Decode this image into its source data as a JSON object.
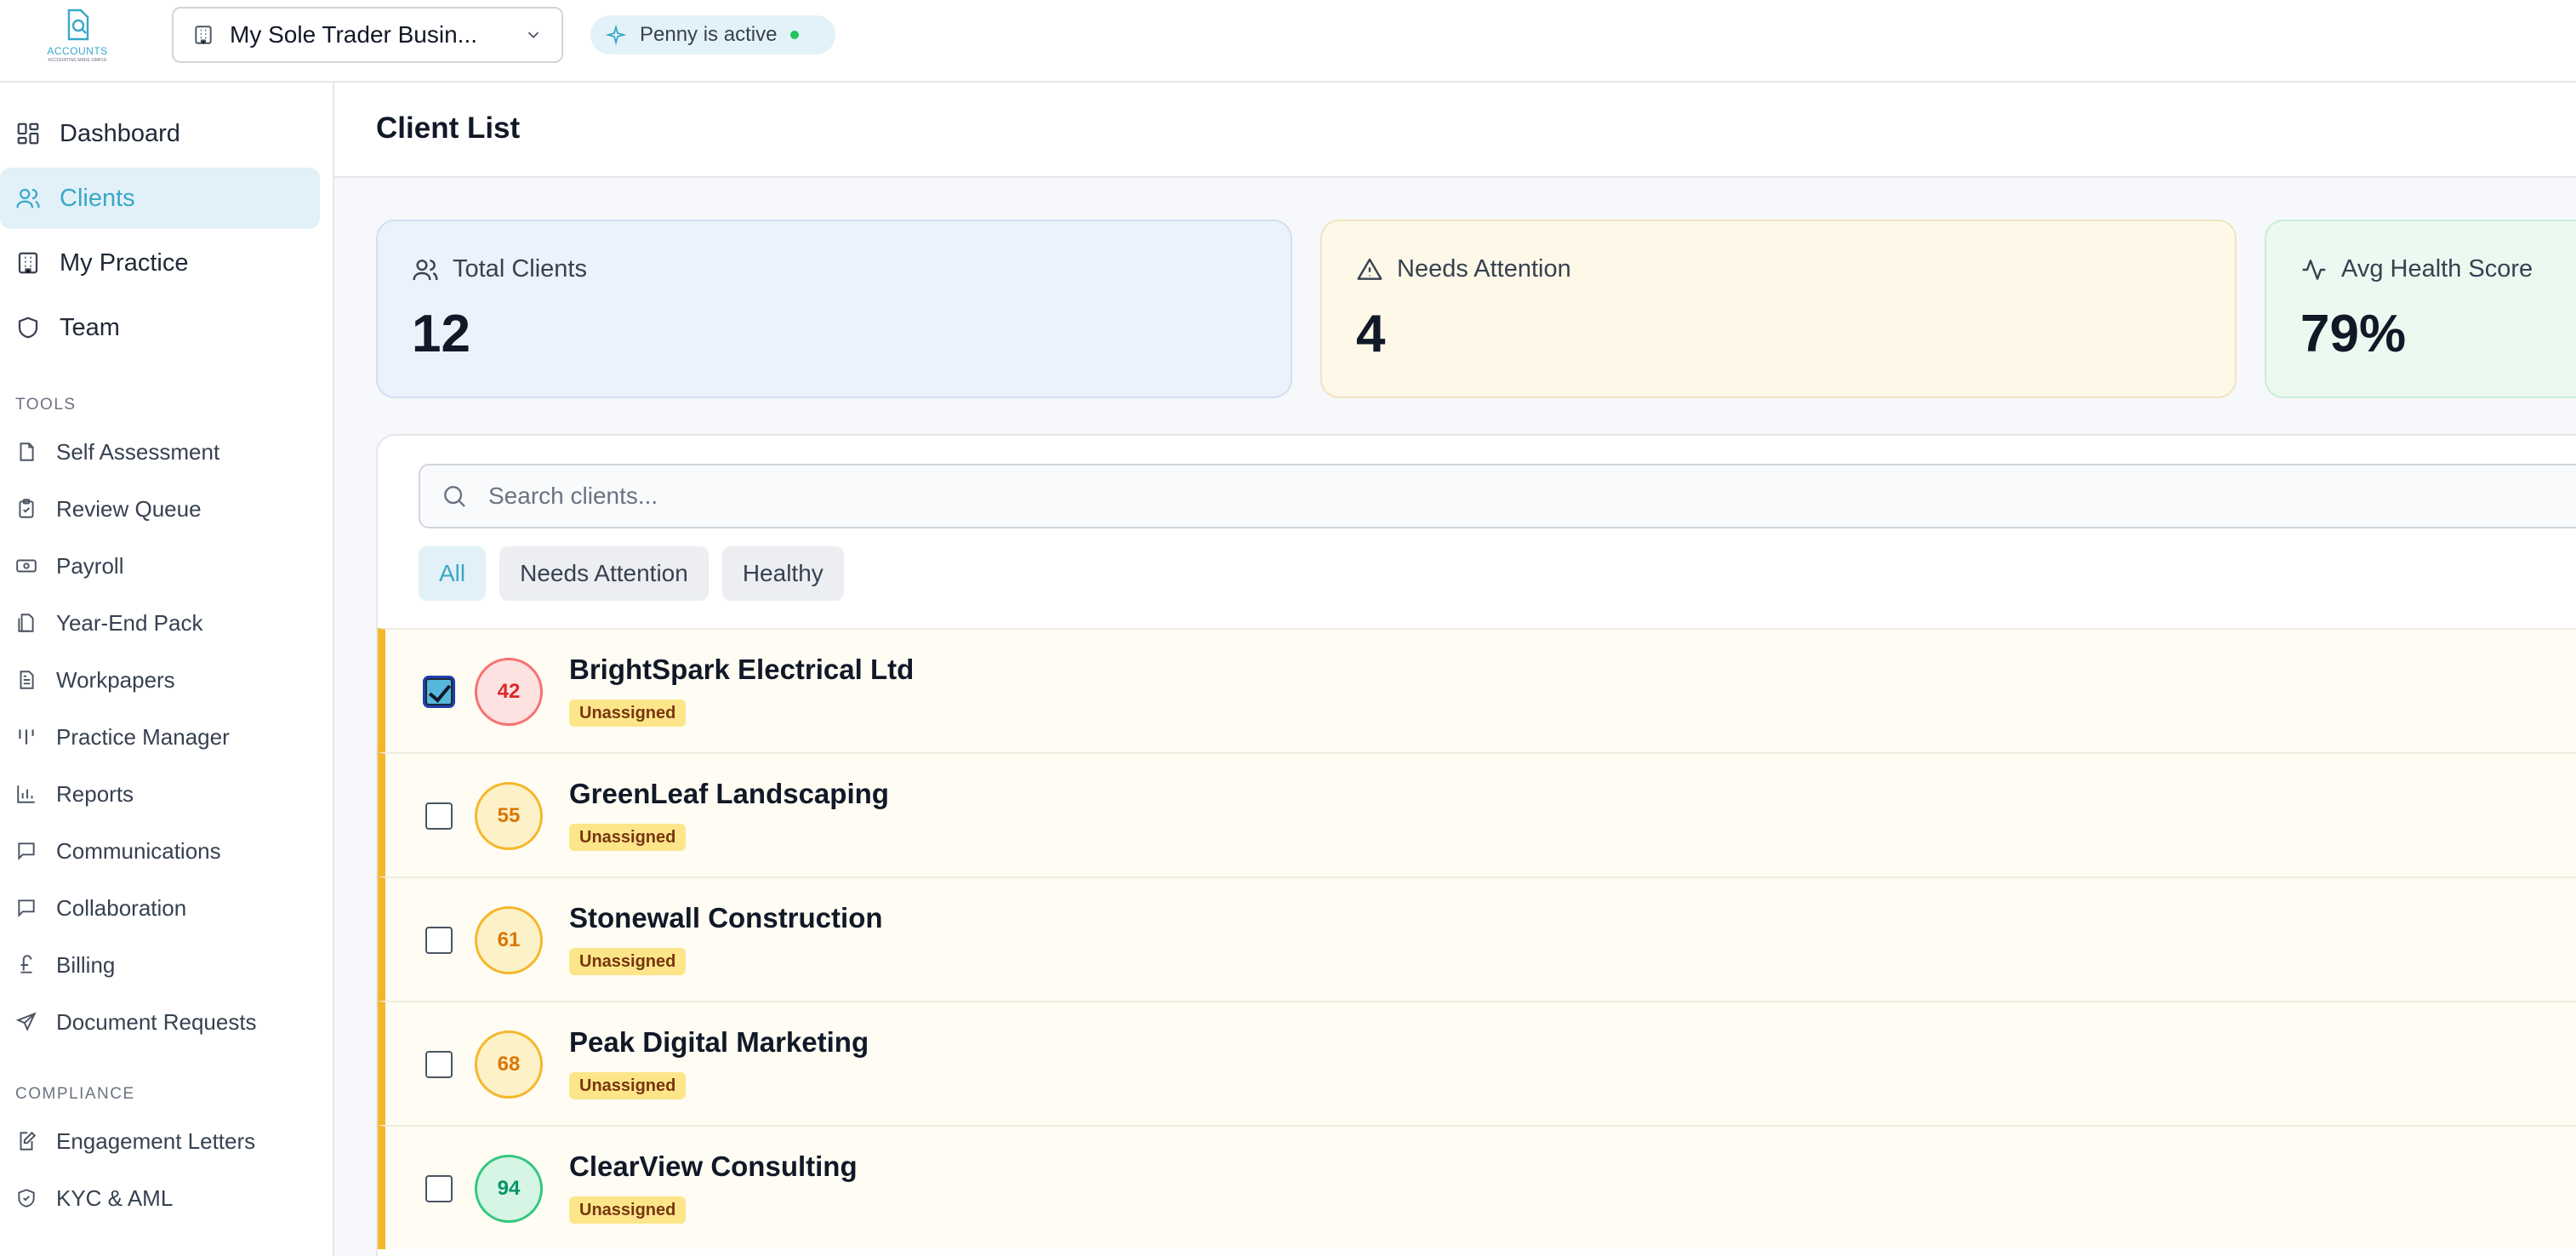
{
  "app": {
    "logo_text": "ACCOUNTS",
    "logo_sub": "ACCOUNTING MADE SIMPLE",
    "business_select": "My Sole Trader Busin...",
    "penny_status": "Penny is active"
  },
  "sidebar": {
    "main": [
      {
        "label": "Dashboard",
        "icon": "dashboard-icon"
      },
      {
        "label": "Clients",
        "icon": "users-icon",
        "active": true
      },
      {
        "label": "My Practice",
        "icon": "building-icon"
      },
      {
        "label": "Team",
        "icon": "shield-icon"
      }
    ],
    "tools_heading": "TOOLS",
    "tools": [
      {
        "label": "Self Assessment",
        "icon": "document-icon"
      },
      {
        "label": "Review Queue",
        "icon": "clipboard-check-icon"
      },
      {
        "label": "Payroll",
        "icon": "banknote-icon"
      },
      {
        "label": "Year-End Pack",
        "icon": "file-stack-icon"
      },
      {
        "label": "Workpapers",
        "icon": "file-text-icon"
      },
      {
        "label": "Practice Manager",
        "icon": "kanban-icon"
      },
      {
        "label": "Reports",
        "icon": "bar-chart-icon"
      },
      {
        "label": "Communications",
        "icon": "message-icon"
      },
      {
        "label": "Collaboration",
        "icon": "chat-icon"
      },
      {
        "label": "Billing",
        "icon": "pound-icon"
      },
      {
        "label": "Document Requests",
        "icon": "send-icon"
      }
    ],
    "compliance_heading": "COMPLIANCE",
    "compliance": [
      {
        "label": "Engagement Letters",
        "icon": "file-pen-icon"
      },
      {
        "label": "KYC & AML",
        "icon": "shield-check-icon"
      }
    ]
  },
  "page": {
    "title": "Client List"
  },
  "stats": {
    "total": {
      "label": "Total Clients",
      "value": "12"
    },
    "attention": {
      "label": "Needs Attention",
      "value": "4"
    },
    "health": {
      "label": "Avg Health Score",
      "value": "79%"
    }
  },
  "search": {
    "placeholder": "Search clients...",
    "value": ""
  },
  "filters": [
    {
      "label": "All",
      "active": true
    },
    {
      "label": "Needs Attention"
    },
    {
      "label": "Healthy"
    }
  ],
  "clients": [
    {
      "name": "BrightSpark Electrical Ltd",
      "score": "42",
      "tag": "Unassigned",
      "checked": true,
      "level": "red"
    },
    {
      "name": "GreenLeaf Landscaping",
      "score": "55",
      "tag": "Unassigned",
      "checked": false,
      "level": "amber"
    },
    {
      "name": "Stonewall Construction",
      "score": "61",
      "tag": "Unassigned",
      "checked": false,
      "level": "amber"
    },
    {
      "name": "Peak Digital Marketing",
      "score": "68",
      "tag": "Unassigned",
      "checked": false,
      "level": "amber"
    },
    {
      "name": "ClearView Consulting",
      "score": "94",
      "tag": "Unassigned",
      "checked": false,
      "level": "green"
    }
  ],
  "colors": {
    "accent": "#3aa7c9",
    "attention_bar": "#f5b72a",
    "tag_bg": "#fde68a"
  }
}
